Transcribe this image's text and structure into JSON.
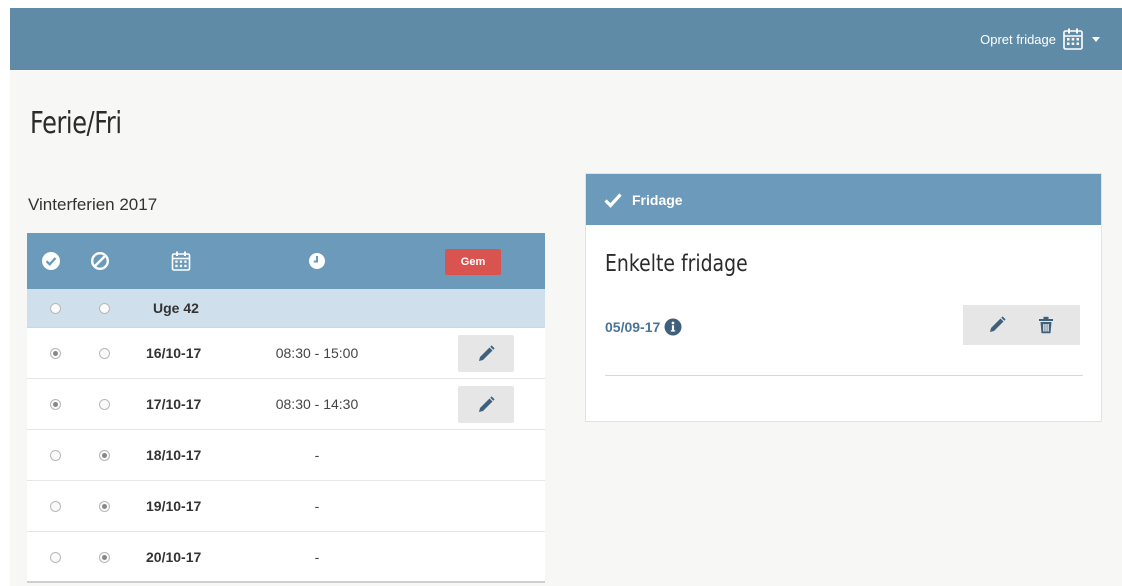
{
  "header": {
    "create_label": "Opret fridage",
    "icon": "calendar-icon",
    "bg_color": "#5f8ba7"
  },
  "page_title": "Ferie/Fri",
  "group_title": "Vinterferien 2017",
  "table": {
    "header_icons": [
      "check-circle-icon",
      "ban-icon",
      "calendar-icon",
      "clock-icon"
    ],
    "save_label": "Gem",
    "week": {
      "label": "Uge 42",
      "approve": false,
      "reject": false
    },
    "rows": [
      {
        "date": "16/10-17",
        "time": "08:30 - 15:00",
        "approve": true,
        "reject": false,
        "editable": true
      },
      {
        "date": "17/10-17",
        "time": "08:30 - 14:30",
        "approve": true,
        "reject": false,
        "editable": true
      },
      {
        "date": "18/10-17",
        "time": "-",
        "approve": false,
        "reject": true,
        "editable": false
      },
      {
        "date": "19/10-17",
        "time": "-",
        "approve": false,
        "reject": true,
        "editable": false
      },
      {
        "date": "20/10-17",
        "time": "-",
        "approve": false,
        "reject": true,
        "editable": false
      }
    ]
  },
  "panel": {
    "title": "Fridage",
    "subtitle": "Enkelte fridage",
    "entries": [
      {
        "date": "05/09-17",
        "info_icon": "info-circle-icon",
        "actions": [
          "pencil-icon",
          "trash-icon"
        ]
      }
    ]
  },
  "colors": {
    "accent": "#6b9abb",
    "save": "#d9534f",
    "week_row": "#cfe0ec",
    "link": "#4a7596"
  }
}
